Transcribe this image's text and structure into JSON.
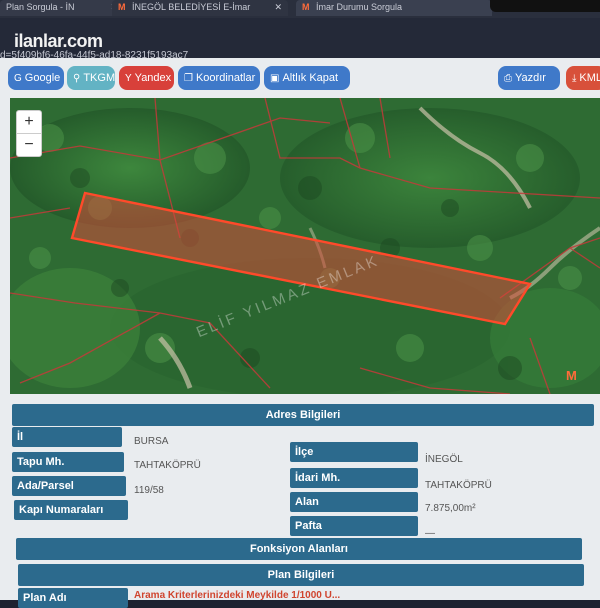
{
  "browser": {
    "tabs": [
      {
        "label": "Plan Sorgula - İN"
      },
      {
        "label": "İNEGÖL BELEDİYESİ E-İmar"
      },
      {
        "label": "İmar Durumu Sorgula"
      }
    ],
    "brand": "ilanlar.com",
    "url": "d=5f409bf6-46fa-44f5-ad18-8231f5193ac7"
  },
  "toolbar": {
    "google": "Google",
    "tkgm": "TKGM",
    "yandex": "Yandex",
    "koordinatlar": "Koordinatlar",
    "altlik": "Altlık Kapat",
    "yazdir": "Yazdır",
    "kml": "KML"
  },
  "map": {
    "zoom_in": "+",
    "zoom_out": "−",
    "watermark": "ELİF YILMAZ EMLAK"
  },
  "adres": {
    "title": "Adres Bilgileri",
    "il_label": "İl",
    "il_value": "BURSA",
    "ilce_label": "İlçe",
    "ilce_value": "İNEGÖL",
    "tapu_label": "Tapu Mh.",
    "tapu_value": "TAHTAKÖPRÜ",
    "idari_label": "İdari Mh.",
    "idari_value": "TAHTAKÖPRÜ",
    "ada_label": "Ada/Parsel",
    "ada_value": "119/58",
    "alan_label": "Alan",
    "alan_value": "7.875,00m²",
    "kapi_label": "Kapı Numaraları",
    "pafta_label": "Pafta",
    "pafta_value": "—"
  },
  "fonksiyon": {
    "title": "Fonksiyon Alanları"
  },
  "plan": {
    "title": "Plan Bilgileri",
    "plan_adi_label": "Plan Adı",
    "notice": "Arama Kriterlerinizdeki Meykilde 1/1000 U..."
  }
}
